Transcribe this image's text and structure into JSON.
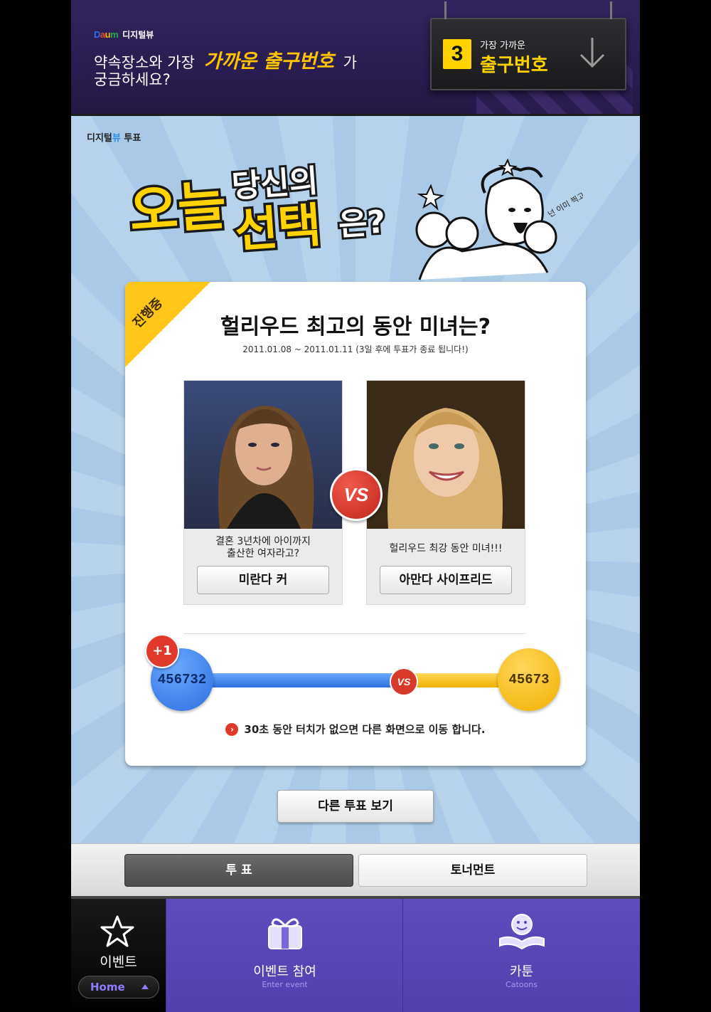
{
  "banner": {
    "brand_logo": "Daum",
    "brand_service": "디지털뷰",
    "line1_prefix": "약속장소와 가장",
    "line1_highlight": "가까운 출구번호",
    "line1_suffix": "가",
    "line2": "궁금하세요?",
    "sign_number": "3",
    "sign_small": "가장 가까운",
    "sign_big": "출구번호",
    "sign_icon": "arrow-down-icon"
  },
  "vote_logo": {
    "prefix": "디지털",
    "mid": "뷰",
    "suffix": " 투표"
  },
  "headline": {
    "word1": "오늘",
    "word2": "당신의",
    "word3": "선택",
    "word4": "은?"
  },
  "mascot_note": "넌 이미 찍고있다",
  "card": {
    "badge": "진행중",
    "title": "헐리우드 최고의 동안 미녀는?",
    "date": "2011.01.08  ~  2011.01.11 (3일 후에 투표가 종료 됩니다!)",
    "vs": "VS",
    "options": [
      {
        "desc_line1": "결혼 3년차에 아이까지",
        "desc_line2": "출산한 여자라고?",
        "button": "미란다 커"
      },
      {
        "desc_line1": "헐리우드 최강 동안 미녀!!!",
        "desc_line2": "",
        "button": "아만다 사이프리드"
      }
    ],
    "plus_one": "+1",
    "vs_small": "VS",
    "counts": {
      "left": "456732",
      "right": "45673"
    },
    "notice": "30초 동안 터치가 없으면 다른 화면으로 이동 합니다."
  },
  "other_button": "다른 투표 보기",
  "tabs": {
    "active": "투 표",
    "inactive": "토너먼트"
  },
  "bottom_nav": {
    "event_label": "이벤트",
    "home_label": "Home",
    "items": [
      {
        "label": "이벤트 참여",
        "sub": "Enter event",
        "icon": "gift-icon"
      },
      {
        "label": "카툰",
        "sub": "Catoons",
        "icon": "cartoon-book-icon"
      }
    ]
  },
  "colors": {
    "accent_yellow": "#ffc61a",
    "blue": "#2d6fe0",
    "red": "#e0392c",
    "purple": "#5a46b8"
  }
}
